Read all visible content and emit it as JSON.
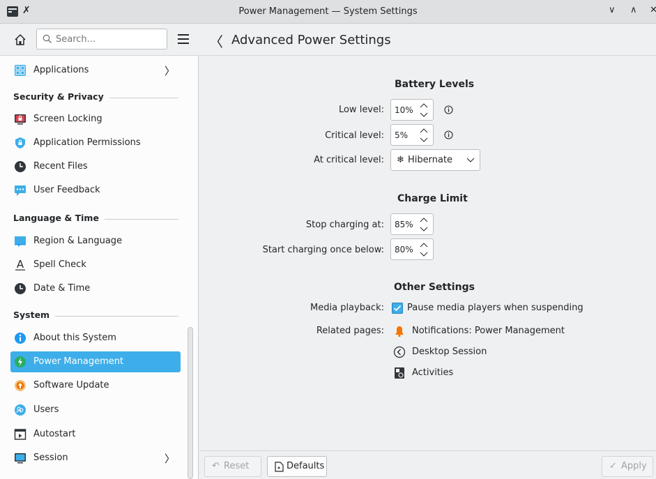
{
  "window": {
    "title": "Power Management — System Settings",
    "controls": {
      "minimize": "∨",
      "maximize": "∧",
      "close": "✕"
    }
  },
  "sidebar": {
    "search_placeholder": "Search...",
    "items": [
      {
        "label": "Applications",
        "icon": "applications-grid-icon",
        "has_children": true
      },
      {
        "category": "Security & Privacy"
      },
      {
        "label": "Screen Locking",
        "icon": "screen-lock-icon"
      },
      {
        "label": "Application Permissions",
        "icon": "shield-icon"
      },
      {
        "label": "Recent Files",
        "icon": "clock-icon"
      },
      {
        "label": "User Feedback",
        "icon": "feedback-chat-icon"
      },
      {
        "category": "Language & Time"
      },
      {
        "label": "Region & Language",
        "icon": "flag-icon"
      },
      {
        "label": "Spell Check",
        "icon": "spell-check-icon"
      },
      {
        "label": "Date & Time",
        "icon": "clock-icon"
      },
      {
        "category": "System"
      },
      {
        "label": "About this System",
        "icon": "info-icon"
      },
      {
        "label": "Power Management",
        "icon": "power-icon",
        "active": true
      },
      {
        "label": "Software Update",
        "icon": "update-icon"
      },
      {
        "label": "Users",
        "icon": "users-icon"
      },
      {
        "label": "Autostart",
        "icon": "autostart-icon"
      },
      {
        "label": "Session",
        "icon": "session-monitor-icon",
        "has_children": true
      }
    ]
  },
  "main": {
    "title": "Advanced Power Settings",
    "battery_levels": {
      "heading": "Battery Levels",
      "low_label": "Low level:",
      "low_value": "10%",
      "critical_label": "Critical level:",
      "critical_value": "5%",
      "at_critical_label": "At critical level:",
      "at_critical_value": "Hibernate"
    },
    "charge_limit": {
      "heading": "Charge Limit",
      "stop_label": "Stop charging at:",
      "stop_value": "85%",
      "start_label": "Start charging once below:",
      "start_value": "80%"
    },
    "other_settings": {
      "heading": "Other Settings",
      "media_label": "Media playback:",
      "media_checkbox_label": "Pause media players when suspending",
      "media_checked": true,
      "related_label": "Related pages:",
      "related_pages": [
        "Notifications: Power Management",
        "Desktop Session",
        "Activities"
      ]
    }
  },
  "footer": {
    "reset_label": "Reset",
    "defaults_label": "Defaults",
    "apply_label": "Apply"
  },
  "colors": {
    "accent": "#3daee9",
    "window_bg": "#eff0f1",
    "view_bg": "#fcfcfc",
    "text": "#232629"
  }
}
